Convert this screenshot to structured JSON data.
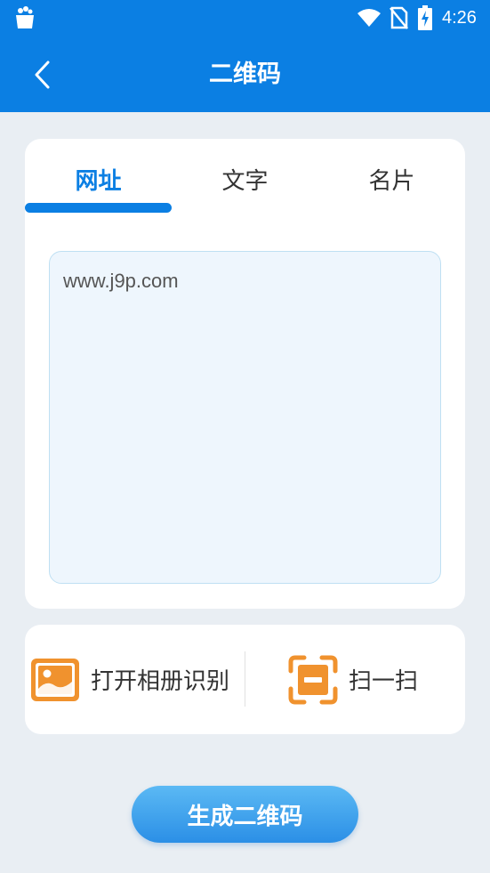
{
  "status_bar": {
    "time": "4:26",
    "icons": [
      "shop-icon",
      "wifi-icon",
      "sim-icon",
      "battery-icon"
    ]
  },
  "app_bar": {
    "title": "二维码",
    "back_icon": "chevron-left-icon"
  },
  "tabs": [
    {
      "label": "网址",
      "active": true
    },
    {
      "label": "文字",
      "active": false
    },
    {
      "label": "名片",
      "active": false
    }
  ],
  "input": {
    "value": "www.j9p.com"
  },
  "actions": {
    "album": {
      "label": "打开相册识别",
      "icon": "image-icon"
    },
    "scan": {
      "label": "扫一扫",
      "icon": "scan-icon"
    }
  },
  "generate_button": {
    "label": "生成二维码"
  },
  "colors": {
    "primary": "#0b7fe3",
    "background": "#e9eef3",
    "icon_orange": "#f0922e",
    "input_bg": "#eef6fd"
  }
}
